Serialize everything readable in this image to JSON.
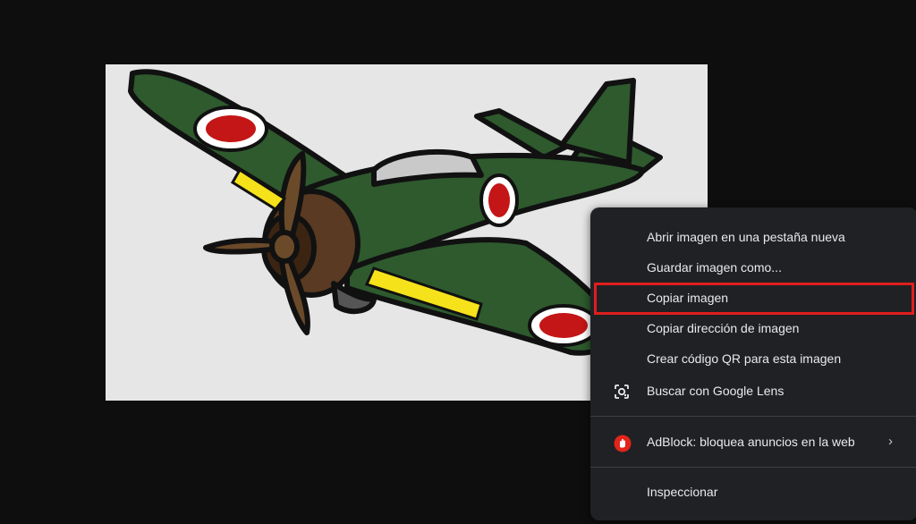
{
  "image": {
    "subject_icon": "green-warplane-illustration",
    "background_color": "#e6e6e6"
  },
  "context_menu": {
    "items": [
      {
        "label": "Abrir imagen en una pestaña nueva"
      },
      {
        "label": "Guardar imagen como..."
      },
      {
        "label": "Copiar imagen",
        "highlighted": true
      },
      {
        "label": "Copiar dirección de imagen"
      },
      {
        "label": "Crear código QR para esta imagen"
      },
      {
        "label": "Buscar con Google Lens",
        "icon": "google-lens-icon"
      },
      {
        "label": "AdBlock: bloquea anuncios en la web",
        "icon": "adblock-icon",
        "submenu": true
      },
      {
        "label": "Inspeccionar"
      }
    ],
    "highlight_color": "#e01e1e"
  }
}
